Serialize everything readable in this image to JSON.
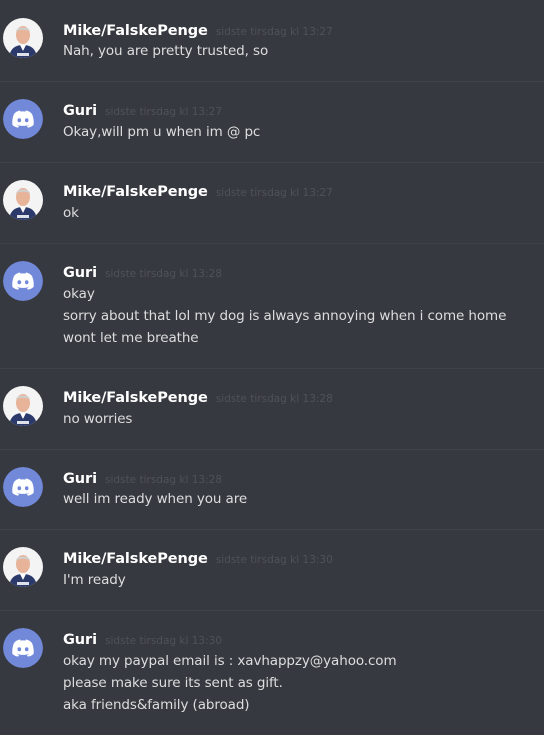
{
  "messages": [
    {
      "author": "Mike/FalskePenge",
      "avatar": "mike-photo-avatar",
      "timestamp": "sidste tirsdag kl 13:27",
      "lines": [
        "Nah, you are pretty trusted, so"
      ]
    },
    {
      "author": "Guri",
      "avatar": "discord-default-avatar",
      "timestamp": "sidste tirsdag kl 13:27",
      "lines": [
        "Okay,will pm u when im @ pc"
      ]
    },
    {
      "author": "Mike/FalskePenge",
      "avatar": "mike-photo-avatar",
      "timestamp": "sidste tirsdag kl 13:27",
      "lines": [
        "ok"
      ]
    },
    {
      "author": "Guri",
      "avatar": "discord-default-avatar",
      "timestamp": "sidste tirsdag kl 13:28",
      "lines": [
        "okay",
        "sorry about that lol my dog is always annoying when i come home",
        "wont let me breathe"
      ]
    },
    {
      "author": "Mike/FalskePenge",
      "avatar": "mike-photo-avatar",
      "timestamp": "sidste tirsdag kl 13:28",
      "lines": [
        "no worries"
      ]
    },
    {
      "author": "Guri",
      "avatar": "discord-default-avatar",
      "timestamp": "sidste tirsdag kl 13:28",
      "lines": [
        "well im ready when you are"
      ]
    },
    {
      "author": "Mike/FalskePenge",
      "avatar": "mike-photo-avatar",
      "timestamp": "sidste tirsdag kl 13:30",
      "lines": [
        "I'm ready"
      ]
    },
    {
      "author": "Guri",
      "avatar": "discord-default-avatar",
      "timestamp": "sidste tirsdag kl 13:30",
      "lines": [
        "okay my paypal email is : xavhappzy@yahoo.com",
        "please make sure its sent as gift.",
        "aka friends&family (abroad)"
      ]
    }
  ],
  "colors": {
    "background": "#36393f",
    "username": "#ffffff",
    "timestamp": "#4f5258",
    "message_text": "#dcddde",
    "divider": "#3f4249",
    "discord_blurple": "#7289da"
  }
}
